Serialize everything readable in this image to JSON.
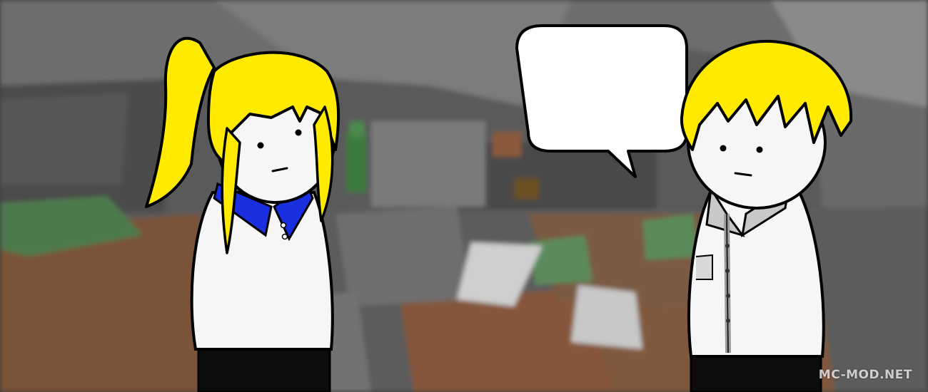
{
  "watermark": {
    "text": "MC-MOD.NET"
  },
  "speech_bubble": {
    "text": ""
  },
  "colors": {
    "hair": "#ffea00",
    "collar_left": "#1a2fe0",
    "collar_right": "#c8c8c8",
    "body": "#f6f6f6",
    "pants": "#0c0c0c",
    "outline": "#000000"
  }
}
